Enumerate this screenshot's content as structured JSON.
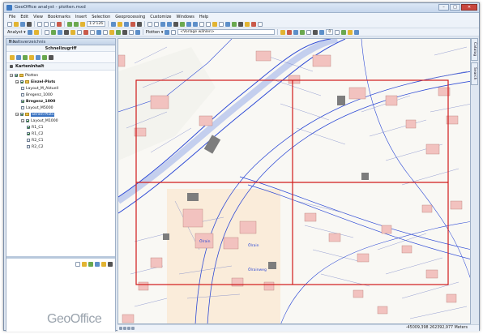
{
  "window": {
    "title": "GeoOffice analyst - plotten.mxd"
  },
  "menu": [
    "File",
    "Edit",
    "View",
    "Bookmarks",
    "Insert",
    "Selection",
    "Geoprocessing",
    "Customize",
    "Windows",
    "Help"
  ],
  "toolbar": {
    "scale": "1:2'126",
    "analyst_label": "Analyst ▾",
    "plotten_label": "Plotten ▾",
    "template_placeholder": "<Vorlage wählen>",
    "zoom_value": "0"
  },
  "toc": {
    "title": "Inhaltsverzeichnis",
    "pin": "₸ ×",
    "quick_access": "Schnellzugriff",
    "content_title": "Karteninhalt",
    "tree": [
      {
        "label": "Plotten",
        "level": 0,
        "checked": true,
        "expander": "−",
        "bold": false,
        "selected": false
      },
      {
        "label": "Einzel-Plots",
        "level": 1,
        "checked": true,
        "expander": "−",
        "bold": true,
        "selected": false
      },
      {
        "label": "Layout_M_Aktuell",
        "level": 2,
        "checked": false,
        "expander": "",
        "bold": false,
        "selected": false
      },
      {
        "label": "Bregenz_1000",
        "level": 2,
        "checked": false,
        "expander": "",
        "bold": false,
        "selected": false
      },
      {
        "label": "Bregenz_1000",
        "level": 2,
        "checked": true,
        "expander": "",
        "bold": true,
        "selected": false
      },
      {
        "label": "Layout_M5000",
        "level": 2,
        "checked": false,
        "expander": "",
        "bold": false,
        "selected": false
      },
      {
        "label": "Serien-Plots",
        "level": 1,
        "checked": true,
        "expander": "−",
        "bold": false,
        "selected": true
      },
      {
        "label": "Layout_M1000",
        "level": 2,
        "checked": true,
        "expander": "−",
        "bold": false,
        "selected": false
      },
      {
        "label": "R1_C1",
        "level": 3,
        "checked": true,
        "expander": "",
        "bold": false,
        "selected": false
      },
      {
        "label": "R1_C2",
        "level": 3,
        "checked": true,
        "expander": "",
        "bold": false,
        "selected": false
      },
      {
        "label": "R2_C1",
        "level": 3,
        "checked": false,
        "expander": "",
        "bold": false,
        "selected": false
      },
      {
        "label": "R2_C2",
        "level": 3,
        "checked": false,
        "expander": "",
        "bold": false,
        "selected": false
      }
    ]
  },
  "logo": {
    "part1": "Geo",
    "part2": "Office"
  },
  "side_tabs": [
    "Catalog",
    "Search"
  ],
  "map": {
    "labels": [
      "Ölrain",
      "Ölrain",
      "Ölrainweg"
    ],
    "plot_frame_color": "#d11a1a"
  },
  "status": {
    "coords": "-45009,398  262392,977 Meters"
  },
  "colors": {
    "accent": "#3a73c2",
    "plot_frame": "#d11a1a",
    "parcel_line": "#2f4bd6",
    "building": "#f2c2bf"
  }
}
